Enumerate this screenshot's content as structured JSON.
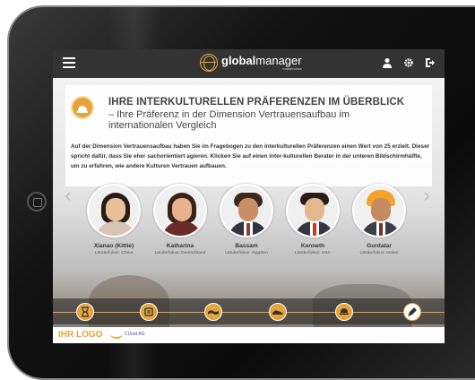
{
  "header": {
    "brand_bold": "global",
    "brand_rest": "manager",
    "brand_sub": "masterclass",
    "icons": [
      "user-icon",
      "gear-icon",
      "logout-icon"
    ]
  },
  "content": {
    "title": "IHRE INTERKULTURELLEN PRÄFERENZEN IM ÜBERBLICK",
    "subtitle": "– Ihre Präferenz in der Dimension Vertrauensaufbau im internationalen Vergleich",
    "description": "Auf der Dimension Vertrauensaufbau haben Sie im Fragebogen zu den interkulturellen Präferenzen einen Wert von 25 erzielt. Dieser spricht dafür, dass Sie eher sachorientiert agieren. Klicken Sie auf einen inter-kulturellen Berater in der unteren Bildschirmhälfte, um zu erfahren, wie andere Kulturen Vertrauen aufbauen."
  },
  "persons": [
    {
      "name": "Xianao (Kittie)",
      "focus": "Länderfokus: China"
    },
    {
      "name": "Katharina",
      "focus": "Länderfokus: Deutschland"
    },
    {
      "name": "Bassam",
      "focus": "Länderfokus: Ägypten"
    },
    {
      "name": "Kenneth",
      "focus": "Länderfokus: USA"
    },
    {
      "name": "Gurdatar",
      "focus": "Länderfokus: Indien"
    }
  ],
  "timeline": {
    "nodes": [
      "1",
      "2",
      "3",
      "4",
      "5",
      "6"
    ],
    "active_index": 5
  },
  "footer": {
    "logo": "IHR LOGO",
    "partner": "CUnet AG"
  },
  "colors": {
    "accent": "#e5a43b",
    "header_bg": "#333333"
  }
}
